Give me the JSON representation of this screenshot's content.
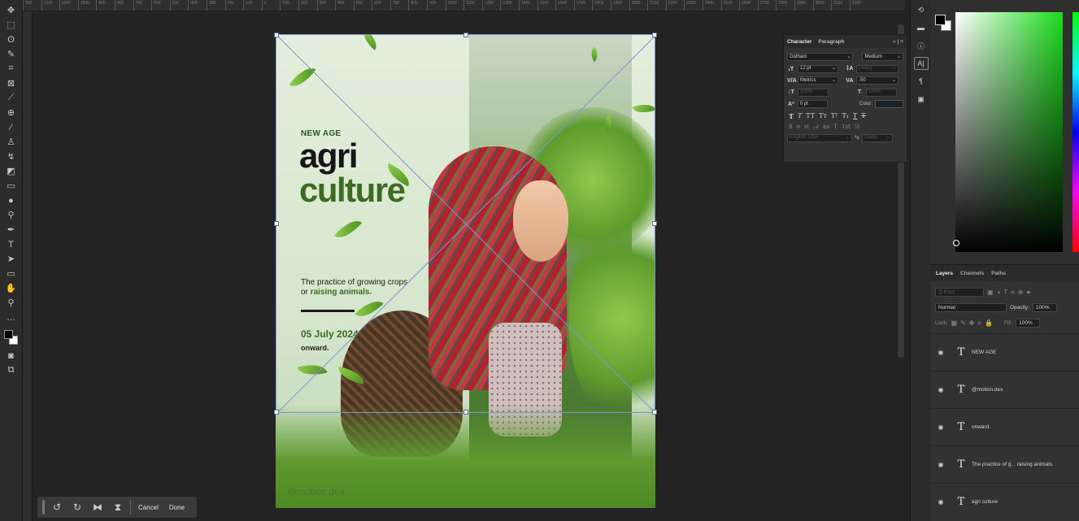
{
  "ruler": {
    "ticks": [
      "300",
      "1200",
      "1100",
      "1000",
      "900",
      "800",
      "700",
      "600",
      "500",
      "400",
      "300",
      "200",
      "100",
      "0",
      "100",
      "200",
      "300",
      "400",
      "500",
      "600",
      "700",
      "800",
      "900",
      "1000",
      "1100",
      "1200",
      "1300",
      "1400",
      "1500",
      "1600",
      "1700",
      "1800",
      "1900",
      "2000",
      "2100",
      "2200",
      "2300",
      "2400",
      "2500",
      "2600",
      "2700",
      "2800",
      "2900",
      "3000",
      "3100",
      "3200"
    ]
  },
  "poster": {
    "eyebrow": "NEW AGE",
    "title_line1": "agri",
    "title_line2": "culture",
    "description_part1": "The practice of growing crops",
    "description_part2": "or ",
    "description_highlight": "raising animals.",
    "date": "05 July 2024",
    "onward": "onward.",
    "credit": "@motion.dex"
  },
  "transform_bar": {
    "cancel": "Cancel",
    "done": "Done"
  },
  "character_panel": {
    "tab_character": "Character",
    "tab_paragraph": "Paragraph",
    "font_family": "Gotham",
    "font_style": "Medium",
    "font_size": "12 pt",
    "leading": "(Auto)",
    "kerning": "Metrics",
    "tracking": "-50",
    "vertical_scale": "100%",
    "horizontal_scale": "100%",
    "baseline_shift": "0 pt",
    "color_label": "Color:",
    "language": "English: USA",
    "aa_label": "ªa",
    "antialias": "Sharp"
  },
  "layers_panel": {
    "tabs": [
      "Layers",
      "Channels",
      "Paths"
    ],
    "filter_kind": "Q Kind",
    "blend_mode": "Normal",
    "opacity_label": "Opacity:",
    "opacity_value": "100%",
    "lock_label": "Lock:",
    "fill_label": "Fill:",
    "fill_value": "100%",
    "layers": [
      "NEW AGE",
      "@motion.dex",
      "onward.",
      "The practice of g... raising animals.",
      "agri culture"
    ]
  }
}
